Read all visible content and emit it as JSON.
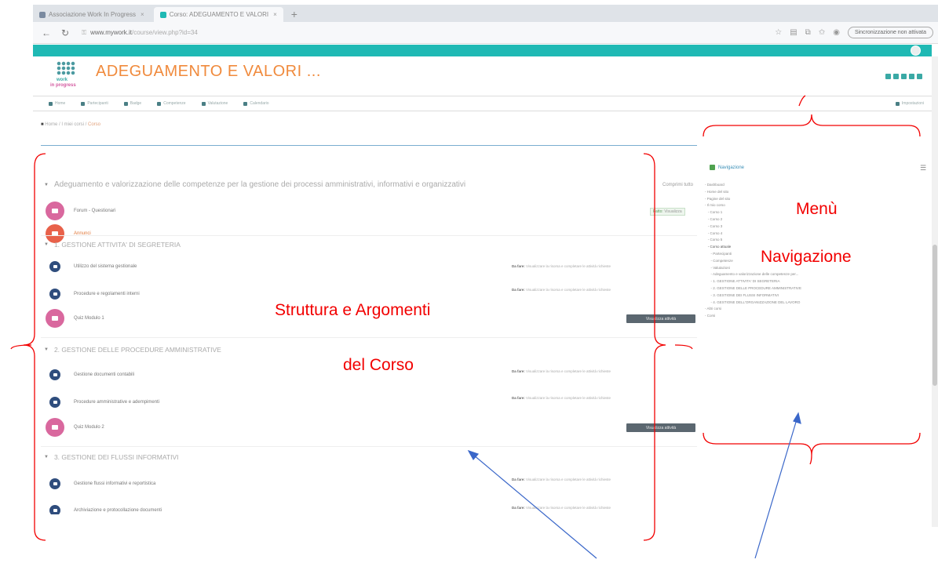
{
  "browser": {
    "tabs": [
      {
        "label": "Associazione Work In Progress",
        "active": false,
        "favicon_color": "#7a8aa0"
      },
      {
        "label": "Corso: ADEGUAMENTO E VALORI",
        "active": true,
        "favicon_color": "#1fb9b4"
      }
    ],
    "new_tab_glyph": "+",
    "url_host": "www.mywork.it",
    "url_path": "/course/view.php?id=34",
    "sync_button": "Sincronizzazione non attivata",
    "nav_icons": [
      "back-icon",
      "refresh-icon"
    ],
    "tool_icons": [
      "star-icon",
      "reading-icon",
      "collections-icon",
      "favorites-icon",
      "profile-icon"
    ]
  },
  "site": {
    "accent_color": "#1fb9b4",
    "title_color": "#f08a3c",
    "logo": {
      "line1": "work",
      "line2": "in progress"
    },
    "course_title": "ADEGUAMENTO E VALORI ...",
    "subnav": [
      "Home",
      "Partecipanti",
      "Badge",
      "Competenze",
      "Valutazione",
      "Calendario"
    ],
    "subnav_right": "Impostazioni",
    "breadcrumb": {
      "home": "Home",
      "parent": "I miei corsi",
      "current": "Corso"
    }
  },
  "course": {
    "intro": "Adeguamento e valorizzazione delle competenze per la gestione dei processi amministrativi, informativi e organizzativi",
    "collapse_all": "Comprimi tutto",
    "top_activities": [
      {
        "name": "Forum - Questionari",
        "icon_color": "#d9689e",
        "done_label": "Fatto:",
        "done_value": "Visualizza"
      },
      {
        "name": "Annunci",
        "icon_color": "#e8614a"
      }
    ],
    "sections": [
      {
        "title": "1. GESTIONE ATTIVITA' DI SEGRETERIA",
        "activities": [
          {
            "name": "Utilizzo del sistema gestionale",
            "icon": "blue",
            "info_label": "Da fare:",
            "info": "Visualizzare la risorsa e completare le attività richieste"
          },
          {
            "name": "Procedure e regolamenti interni",
            "icon": "blue",
            "info_label": "Da fare:",
            "info": "Visualizzare la risorsa e completare le attività richieste"
          },
          {
            "name": "Quiz Modulo 1",
            "icon": "pink",
            "button": "Visualizza attività"
          }
        ]
      },
      {
        "title": "2. GESTIONE DELLE PROCEDURE AMMINISTRATIVE",
        "activities": [
          {
            "name": "Gestione documenti contabili",
            "icon": "blue",
            "info_label": "Da fare:",
            "info": "Visualizzare la risorsa e completare le attività richieste"
          },
          {
            "name": "Procedure amministrative e adempimenti",
            "icon": "blue",
            "info_label": "Da fare:",
            "info": "Visualizzare la risorsa e completare le attività richieste"
          },
          {
            "name": "Quiz Modulo 2",
            "icon": "pink",
            "button": "Visualizza attività"
          }
        ]
      },
      {
        "title": "3. GESTIONE DEI FLUSSI INFORMATIVI",
        "activities": [
          {
            "name": "Gestione flussi informativi e reportistica",
            "icon": "blue",
            "info_label": "Da fare:",
            "info": "Visualizzare la risorsa e completare le attività richieste"
          },
          {
            "name": "Archiviazione e protocollazione documenti",
            "icon": "blue",
            "info_label": "Da fare:",
            "info": "Visualizzare la risorsa e completare le attività richieste"
          }
        ]
      }
    ]
  },
  "navigation": {
    "title": "Navigazione",
    "tree": [
      {
        "label": "- Dashboard",
        "open": false
      },
      {
        "label": "- Home del sito",
        "open": false
      },
      {
        "label": "- Pagine del sito",
        "open": false
      },
      {
        "label": "- Il mio corso",
        "open": false
      },
      {
        "label": "   - Corso 1",
        "open": false
      },
      {
        "label": "   - Corso 2",
        "open": false
      },
      {
        "label": "   - Corso 3",
        "open": false
      },
      {
        "label": "   - Corso 4",
        "open": false
      },
      {
        "label": "   - Corso 5",
        "open": false
      },
      {
        "label": "   - Corso attuale",
        "open": true
      },
      {
        "label": "      - Partecipanti",
        "open": false
      },
      {
        "label": "      - Competenze",
        "open": false
      },
      {
        "label": "      - Valutazioni",
        "open": false
      },
      {
        "label": "      - Adeguamento e valorizzazione delle competenze per...",
        "open": false
      },
      {
        "label": "      - 1. GESTIONE ATTIVITA' DI SEGRETERIA",
        "open": false
      },
      {
        "label": "      - 2. GESTIONE DELLE PROCEDURE AMMINISTRATIVE",
        "open": false
      },
      {
        "label": "      - 3. GESTIONE DEI FLUSSI INFORMATIVI",
        "open": false
      },
      {
        "label": "      - 4. GESTIONE DELL'ORGANIZZAZIONE DEL LAVORO",
        "open": false
      },
      {
        "label": "- Altri corsi",
        "open": false
      },
      {
        "label": "- Corsi",
        "open": false
      }
    ]
  },
  "annotations": {
    "color": "#f20000",
    "content_label_line1": "Struttura e Argomenti",
    "content_label_line2": "del Corso",
    "nav_label_line1": "Menù",
    "nav_label_line2": "Navigazione",
    "arrow_color": "#3a67c9"
  }
}
